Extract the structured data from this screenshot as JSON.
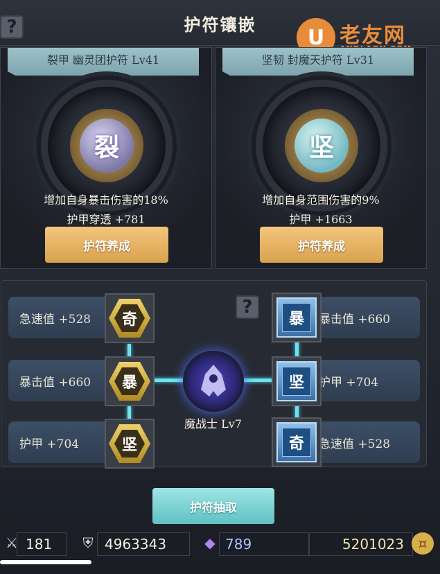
{
  "header": {
    "title": "护符镶嵌",
    "help": "?"
  },
  "watermark": {
    "logo_char": "U",
    "name": "老友网",
    "domain": "ANDLAOU.COM"
  },
  "cards": [
    {
      "banner": "裂甲 幽灵团护符 Lv41",
      "gem_char": "裂",
      "desc1": "增加自身暴击伤害的18%",
      "desc2": "护甲穿透 +781",
      "button": "护符养成"
    },
    {
      "banner": "坚韧 封魔天护符 Lv31",
      "gem_char": "坚",
      "desc1": "增加自身范围伤害的9%",
      "desc2": "护甲 +1663",
      "button": "护符养成"
    }
  ],
  "left_stats": [
    "急速值 +528",
    "暴击值 +660",
    "护甲 +704"
  ],
  "left_runes": [
    "奇",
    "暴",
    "坚"
  ],
  "right_stats": [
    "暴击值 +660",
    "护甲 +704",
    "急速值 +528"
  ],
  "right_runes": [
    "暴",
    "坚",
    "奇"
  ],
  "panel_help": "?",
  "character": {
    "label": "魔战士 Lv7"
  },
  "draw_button": "护符抽取",
  "currency": [
    "181",
    "4963343",
    "789",
    "5201023"
  ]
}
